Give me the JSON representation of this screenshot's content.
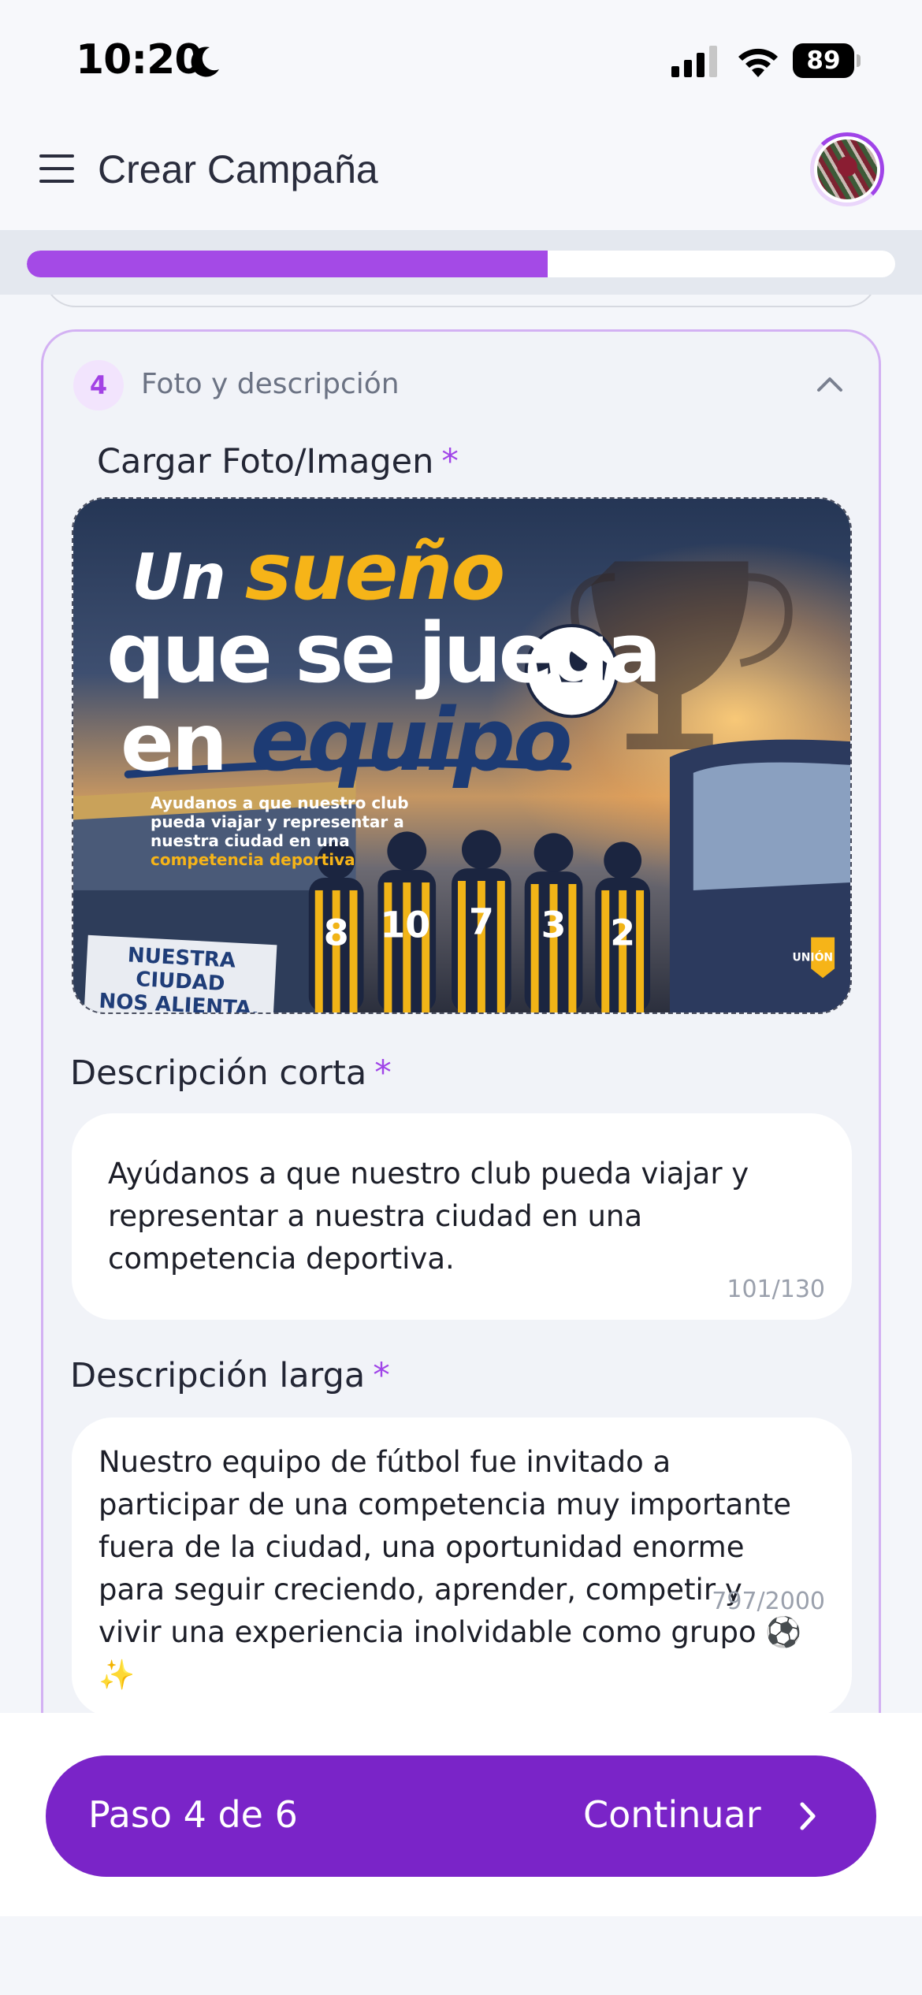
{
  "status_bar": {
    "time": "10:20",
    "battery": "89",
    "icons": [
      "moon-icon",
      "signal-icon",
      "wifi-icon",
      "battery-icon"
    ]
  },
  "header": {
    "title": "Crear Campaña",
    "icons": [
      "menu-icon",
      "avatar"
    ]
  },
  "progress": {
    "fraction": 0.6,
    "colors": {
      "fill": "#a44ae6",
      "track": "#ffffff"
    }
  },
  "section": {
    "number": "4",
    "title": "Foto y descripción",
    "icon": "chevron-up-icon"
  },
  "photo": {
    "label": "Cargar Foto/Imagen",
    "required_mark": "*",
    "promo": {
      "line1_a": "Un",
      "line1_b": "sueño",
      "line2": "que se juega",
      "line3_a": "en",
      "line3_b": "equipo",
      "subtext": "Ayudanos a que nuestro club\npueda viajar y representar a\nnuestra ciudad en una",
      "subtext_highlight": "competencia deportiva",
      "banner": "NUESTRA CIUDAD\nNOS ALIENTA,\nVOS PODÉS",
      "jersey_numbers": [
        "10",
        "7",
        "3",
        "8",
        "2"
      ],
      "bus_logo": "UNIÓN"
    }
  },
  "short_description": {
    "label": "Descripción corta",
    "required_mark": "*",
    "value": "Ayúdanos a que nuestro club pueda viajar y\nrepresentar a nuestra ciudad en una\ncompetencia deportiva.",
    "counter": "101/130"
  },
  "long_description": {
    "label": "Descripción larga",
    "required_mark": "*",
    "value": "Nuestro equipo de fútbol fue invitado a\nparticipar de una competencia muy importante\nfuera de la ciudad, una oportunidad enorme\npara seguir creciendo, aprender, competir y\nvivir una experiencia inolvidable como grupo ⚽\n✨",
    "counter": "797/2000"
  },
  "footer": {
    "step_text": "Paso 4 de 6",
    "continue_label": "Continuar",
    "icon": "chevron-right-icon",
    "button_color": "#7a24c8"
  }
}
